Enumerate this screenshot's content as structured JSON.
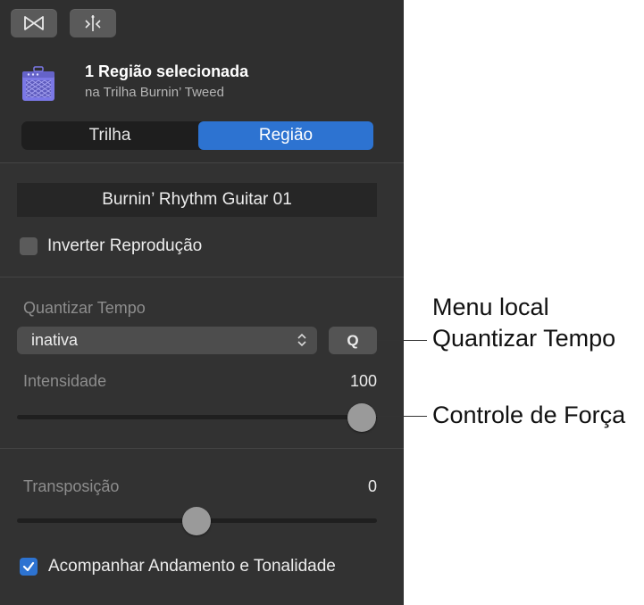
{
  "toolbar": {
    "buttons": [
      {
        "name": "bowtie-icon"
      },
      {
        "name": "merge-split-icon"
      }
    ]
  },
  "header": {
    "icon": "amp-icon",
    "title": "1 Região selecionada",
    "subtitle": "na Trilha Burnin’ Tweed"
  },
  "tabs": {
    "track_label": "Trilha",
    "region_label": "Região",
    "selected": "Região"
  },
  "region": {
    "name": "Burnin’ Rhythm Guitar 01",
    "reverse_label": "Inverter Reprodução",
    "reverse_checked": false
  },
  "quantize": {
    "section_label": "Quantizar Tempo",
    "popup_value": "inativa",
    "q_button_label": "Q",
    "strength_label": "Intensidade",
    "strength_value": "100",
    "strength_fraction": 1.0
  },
  "transpose": {
    "label": "Transposição",
    "value": "0",
    "slider_fraction": 0.5
  },
  "follow": {
    "label": "Acompanhar Andamento e Tonalidade",
    "checked": true
  },
  "callouts": {
    "quantize_line1": "Menu local",
    "quantize_line2": "Quantizar Tempo",
    "strength": "Controle de Força"
  },
  "colors": {
    "accent": "#2d73d1",
    "panel_bg": "#323232",
    "amp_icon": "#7b78e6"
  }
}
